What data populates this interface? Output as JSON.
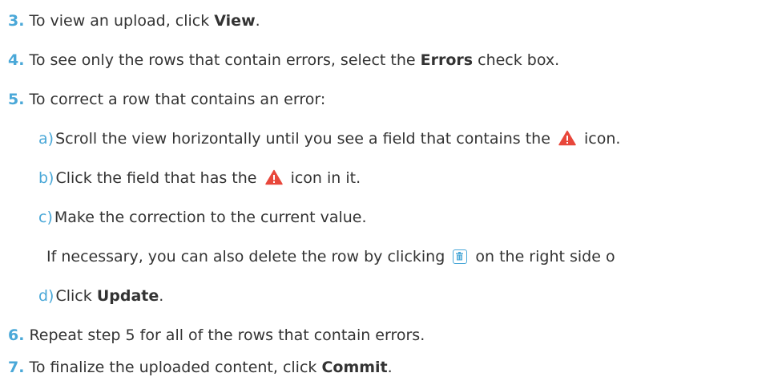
{
  "steps": [
    {
      "number": "3.",
      "pre": "To view an upload, click ",
      "bold": "View",
      "post": "."
    },
    {
      "number": "4.",
      "pre": "To see only the rows that contain errors, select the ",
      "bold": "Errors",
      "post": " check box."
    },
    {
      "number": "5.",
      "text": "To correct a row that contains an error:",
      "substeps": {
        "a": {
          "letter": "a)",
          "pre": "Scroll the view horizontally until you see a field that contains the ",
          "post": " icon."
        },
        "b": {
          "letter": "b)",
          "pre": "Click the field that has the ",
          "post": " icon in it."
        },
        "c": {
          "letter": "c)",
          "text": "Make the correction to the current value."
        },
        "note": {
          "pre": "If necessary, you can also delete the row by clicking ",
          "post": " on the right side o"
        },
        "d": {
          "letter": "d)",
          "pre": "Click ",
          "bold": "Update",
          "post": "."
        }
      }
    },
    {
      "number": "6.",
      "text": "Repeat step 5 for all of the rows that contain errors."
    },
    {
      "number": "7.",
      "pre": "To finalize the uploaded content, click ",
      "bold": "Commit",
      "post": "."
    }
  ],
  "icons": {
    "warning": "warning-triangle-icon",
    "delete": "trash-icon"
  },
  "colors": {
    "step_number": "#4aa8d8",
    "body_text": "#333333",
    "warning": "#e8473b",
    "delete_button": "#4aa8d8"
  }
}
